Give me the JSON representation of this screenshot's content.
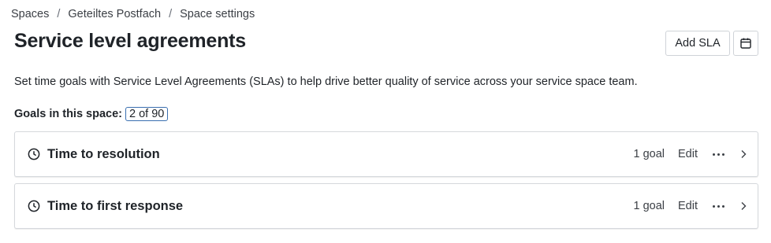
{
  "breadcrumb": {
    "items": [
      "Spaces",
      "Geteiltes Postfach",
      "Space settings"
    ],
    "separator": "/"
  },
  "page": {
    "title": "Service level agreements",
    "description": "Set time goals with Service Level Agreements (SLAs) to help drive better quality of service across your service space team."
  },
  "actions": {
    "add_label": "Add SLA",
    "calendar_icon": "calendar-icon"
  },
  "goals": {
    "label": "Goals in this space:",
    "count": "2 of 90"
  },
  "slas": [
    {
      "title": "Time to resolution",
      "goals": "1 goal",
      "edit": "Edit"
    },
    {
      "title": "Time to first response",
      "goals": "1 goal",
      "edit": "Edit"
    }
  ]
}
